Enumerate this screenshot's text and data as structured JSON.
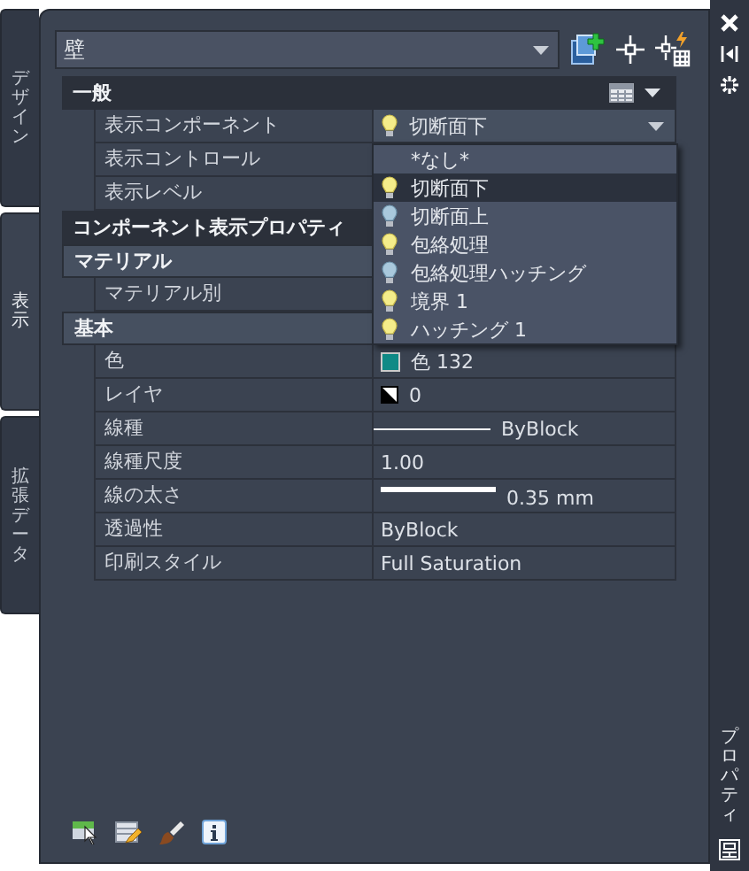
{
  "tabs": [
    {
      "label": "デザイン",
      "selected": false
    },
    {
      "label": "表示",
      "selected": true
    },
    {
      "label": "拡張データ",
      "selected": false
    }
  ],
  "object_combo": {
    "value": "壁"
  },
  "sections": [
    {
      "title": "一般",
      "kind": "header",
      "rows": [
        {
          "label": "表示コンポーネント",
          "kind": "dropdown",
          "value": "切断面下",
          "bulb_on": true
        },
        {
          "label": "表示コントロール"
        },
        {
          "label": "表示レベル"
        }
      ]
    },
    {
      "title": "コンポーネント表示プロパティ",
      "kind": "header"
    },
    {
      "title": "マテリアル",
      "kind": "group",
      "rows": [
        {
          "label": "マテリアル別"
        }
      ]
    },
    {
      "title": "基本",
      "kind": "group",
      "rows": [
        {
          "label": "色",
          "kind": "color",
          "value": "色 132",
          "color": "#0f8a86"
        },
        {
          "label": "レイヤ",
          "kind": "layer",
          "value": "0"
        },
        {
          "label": "線種",
          "kind": "linetype",
          "value": "ByBlock"
        },
        {
          "label": "線種尺度",
          "kind": "text",
          "value": "1.00"
        },
        {
          "label": "線の太さ",
          "kind": "lineweight",
          "value": "0.35 mm"
        },
        {
          "label": "透過性",
          "kind": "text",
          "value": "ByBlock"
        },
        {
          "label": "印刷スタイル",
          "kind": "text",
          "value": "Full Saturation"
        }
      ]
    }
  ],
  "dropdown_list": [
    {
      "label": "*なし*",
      "selected": false
    },
    {
      "label": "切断面下",
      "bulb_on": true,
      "selected": true
    },
    {
      "label": "切断面上",
      "bulb_on": false,
      "selected": false
    },
    {
      "label": "包絡処理",
      "bulb_on": true,
      "selected": false
    },
    {
      "label": "包絡処理ハッチング",
      "bulb_on": false,
      "selected": false
    },
    {
      "label": "境界 1",
      "bulb_on": true,
      "selected": false
    },
    {
      "label": "ハッチング 1",
      "bulb_on": true,
      "selected": false
    }
  ],
  "side_title": "プロパティ"
}
